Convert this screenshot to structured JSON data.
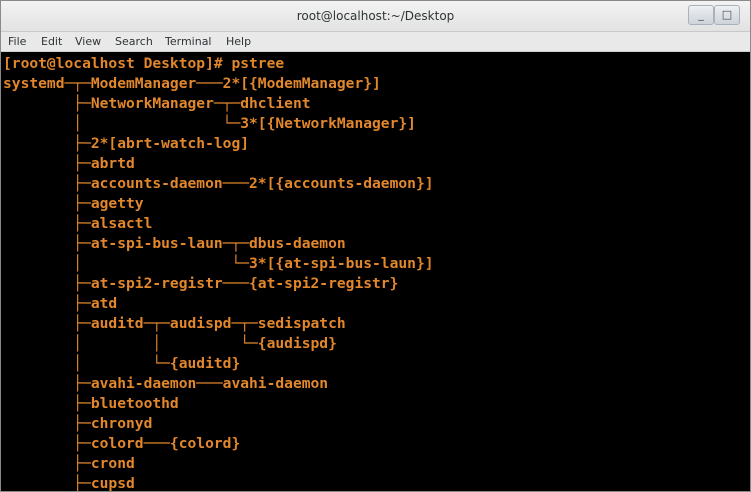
{
  "window": {
    "title": "root@localhost:~/Desktop",
    "minimize_glyph": "_",
    "maximize_glyph": "□"
  },
  "menu": {
    "items": [
      "File",
      "Edit",
      "View",
      "Search",
      "Terminal",
      "Help"
    ]
  },
  "terminal": {
    "text_color": "#e2872c",
    "background": "#000000",
    "lines": [
      "[root@localhost Desktop]# pstree",
      "systemd─┬─ModemManager───2*[{ModemManager}]",
      "        ├─NetworkManager─┬─dhclient",
      "        │                └─3*[{NetworkManager}]",
      "        ├─2*[abrt-watch-log]",
      "        ├─abrtd",
      "        ├─accounts-daemon───2*[{accounts-daemon}]",
      "        ├─agetty",
      "        ├─alsactl",
      "        ├─at-spi-bus-laun─┬─dbus-daemon",
      "        │                 └─3*[{at-spi-bus-laun}]",
      "        ├─at-spi2-registr───{at-spi2-registr}",
      "        ├─atd",
      "        ├─auditd─┬─audispd─┬─sedispatch",
      "        │        │         └─{audispd}",
      "        │        └─{auditd}",
      "        ├─avahi-daemon───avahi-daemon",
      "        ├─bluetoothd",
      "        ├─chronyd",
      "        ├─colord───{colord}",
      "        ├─crond",
      "        ├─cupsd"
    ]
  }
}
